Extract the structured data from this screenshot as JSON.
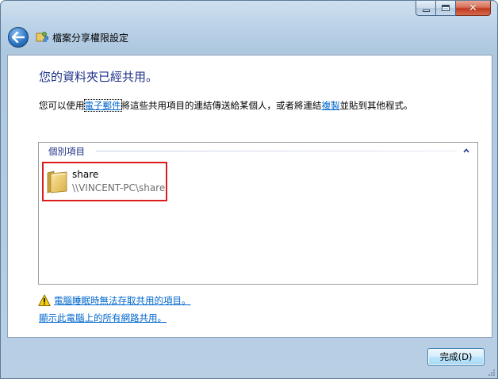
{
  "window": {
    "title": "檔案分享權限設定",
    "caption_buttons": {
      "minimize_icon": "minimize-icon",
      "maximize_icon": "maximize-icon",
      "close_icon": "close-icon",
      "close_glyph": "✕"
    },
    "back_icon": "back-arrow-icon",
    "title_icon": "file-sharing-icon"
  },
  "content": {
    "heading": "您的資料夾已經共用。",
    "desc_prefix": "您可以使用",
    "desc_email_link": "電子郵件",
    "desc_middle": "將這些共用項目的連結傳送給某個人，或者將連結",
    "desc_copy_link": "複製",
    "desc_suffix": "並貼到其他程式。",
    "group": {
      "label": "個別項目",
      "collapse_icon": "chevron-up-icon",
      "items": [
        {
          "name": "share",
          "path": "\\\\VINCENT-PC\\share",
          "icon": "folder-icon"
        }
      ]
    },
    "warning_link": "電腦睡眠時無法存取共用的項目。",
    "warning_icon": "warning-icon",
    "show_all_link": "顯示此電腦上的所有網路共用。"
  },
  "footer": {
    "finish_label": "完成(D)"
  },
  "colors": {
    "heading": "#1e3287",
    "link": "#0066cc",
    "highlight_border": "#dc1c1c",
    "close_button": "#c0391f"
  }
}
